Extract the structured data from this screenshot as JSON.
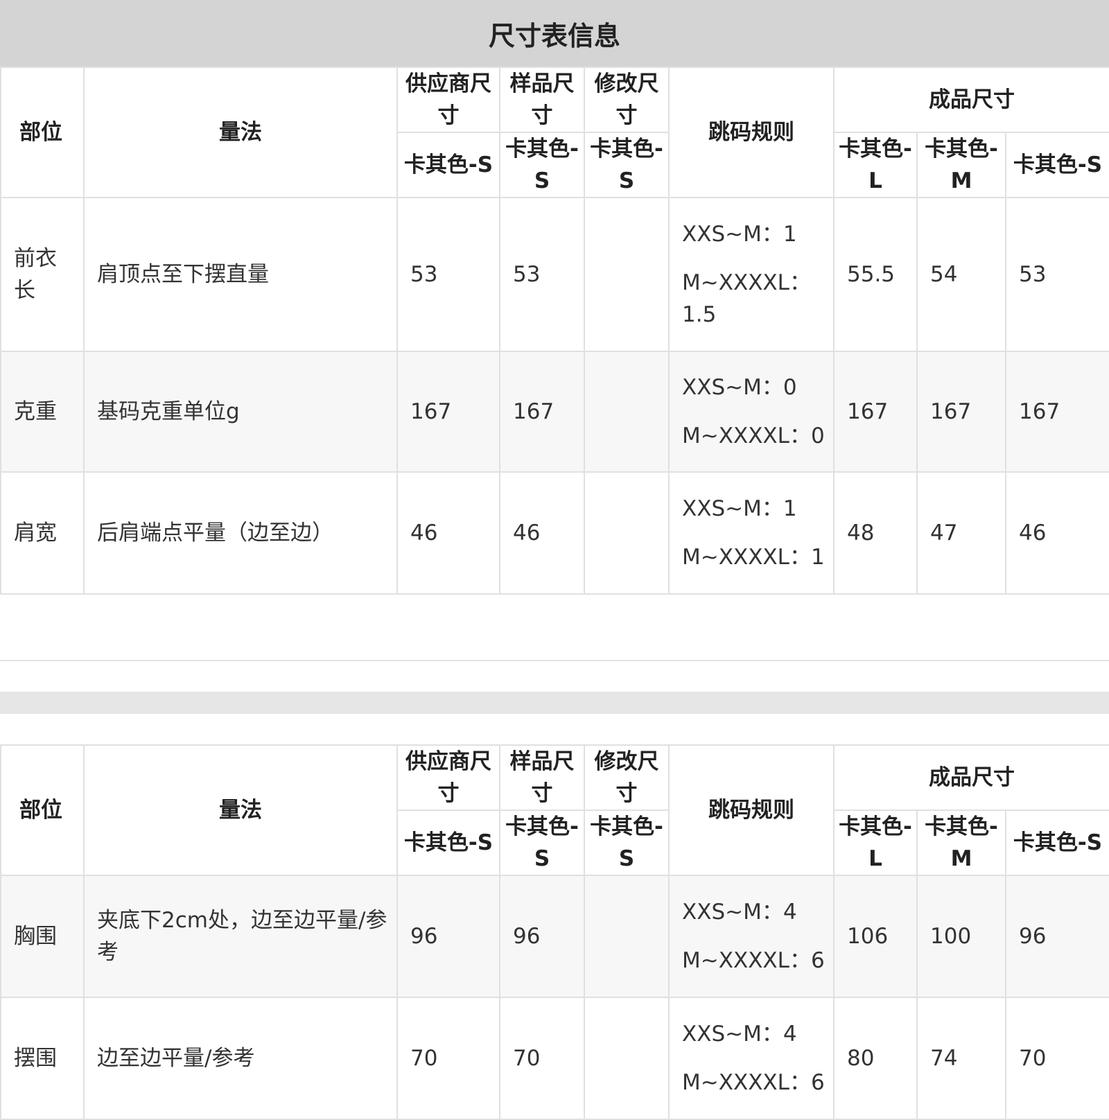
{
  "title": "尺寸表信息",
  "headers": {
    "part": "部位",
    "method": "量法",
    "supplier_size": "供应商尺寸",
    "sample_size": "样品尺寸",
    "modified_size": "修改尺寸",
    "grade_rule": "跳码规则",
    "finished_size": "成品尺寸",
    "supplier_sub": "卡其色-S",
    "sample_sub": "卡其色-S",
    "modified_sub": "卡其色-S",
    "finished_l": "卡其色-L",
    "finished_m": "卡其色-M",
    "finished_s": "卡其色-S"
  },
  "table1": {
    "rows": [
      {
        "part": "前衣长",
        "method": "肩顶点至下摆直量",
        "supplier": "53",
        "sample": "53",
        "modified": "",
        "rule_1": "XXS~M：1",
        "rule_2": "M~XXXXL：1.5",
        "l": "55.5",
        "m": "54",
        "s": "53"
      },
      {
        "part": "克重",
        "method": "基码克重单位g",
        "supplier": "167",
        "sample": "167",
        "modified": "",
        "rule_1": "XXS~M：0",
        "rule_2": "M~XXXXL：0",
        "l": "167",
        "m": "167",
        "s": "167"
      },
      {
        "part": "肩宽",
        "method": "后肩端点平量（边至边）",
        "supplier": "46",
        "sample": "46",
        "modified": "",
        "rule_1": "XXS~M：1",
        "rule_2": "M~XXXXL：1",
        "l": "48",
        "m": "47",
        "s": "46"
      }
    ]
  },
  "table2": {
    "rows": [
      {
        "part": "胸围",
        "method": "夹底下2cm处，边至边平量/参考",
        "supplier": "96",
        "sample": "96",
        "modified": "",
        "rule_1": "XXS~M：4",
        "rule_2": "M~XXXXL：6",
        "l": "106",
        "m": "100",
        "s": "96"
      },
      {
        "part": "摆围",
        "method": "边至边平量/参考",
        "supplier": "70",
        "sample": "70",
        "modified": "",
        "rule_1": "XXS~M：4",
        "rule_2": "M~XXXXL：6",
        "l": "80",
        "m": "74",
        "s": "70"
      }
    ]
  }
}
